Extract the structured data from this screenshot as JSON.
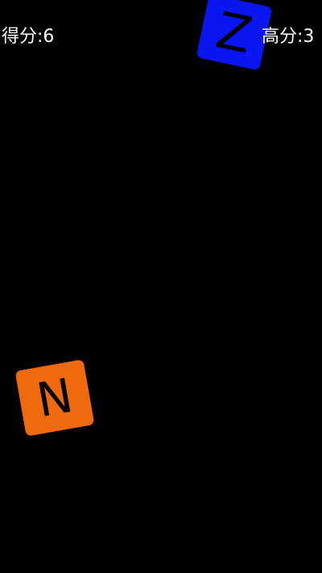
{
  "hud": {
    "score_text": "得分:6",
    "highscore_text": "高分:3"
  },
  "tiles": [
    {
      "letter": "Z",
      "color": "#0a16ef"
    },
    {
      "letter": "N",
      "color": "#ef6a0c"
    }
  ],
  "colors": {
    "background": "#000000",
    "hud_text": "#ffffff",
    "tile_text": "#000000"
  }
}
